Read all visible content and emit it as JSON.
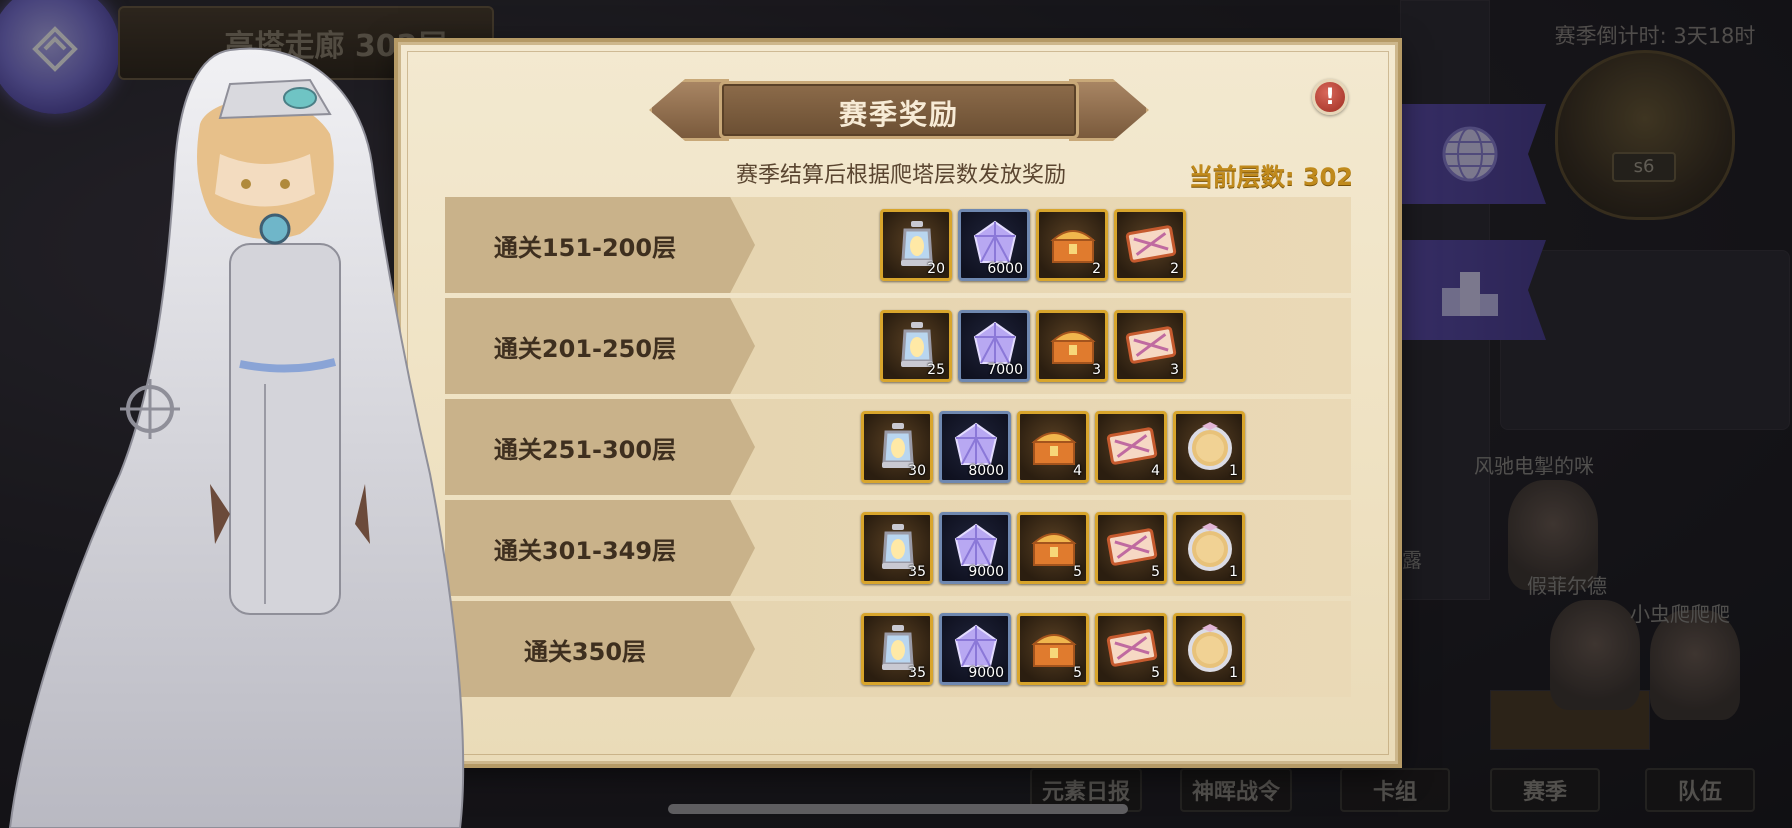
{
  "hud": {
    "tower_title": "高塔走廊 302层",
    "season_countdown": "赛季倒计时: 3天18时",
    "season_badge": "s6"
  },
  "players": [
    {
      "name": "风驰电掣的咪"
    },
    {
      "name": "假菲尔德"
    },
    {
      "name": "小虫爬爬爬"
    },
    {
      "name": "露"
    }
  ],
  "bottom_nav": [
    {
      "label": "元素日报"
    },
    {
      "label": "神晖战令"
    },
    {
      "label": "卡组"
    },
    {
      "label": "赛季"
    },
    {
      "label": "队伍"
    }
  ],
  "panel": {
    "title": "赛季奖励",
    "info_icon": "exclamation-icon",
    "subtitle": "赛季结算后根据爬塔层数发放奖励",
    "current_floor": "当前层数: 302",
    "tiers": [
      {
        "label": "通关151-200层",
        "items": [
          {
            "icon": "lantern",
            "qty": "20"
          },
          {
            "icon": "crystal",
            "qty": "6000"
          },
          {
            "icon": "chest",
            "qty": "2"
          },
          {
            "icon": "ticket",
            "qty": "2"
          }
        ]
      },
      {
        "label": "通关201-250层",
        "items": [
          {
            "icon": "lantern",
            "qty": "25"
          },
          {
            "icon": "crystal",
            "qty": "7000"
          },
          {
            "icon": "chest",
            "qty": "3"
          },
          {
            "icon": "ticket",
            "qty": "3"
          }
        ]
      },
      {
        "label": "通关251-300层",
        "items": [
          {
            "icon": "lantern",
            "qty": "30"
          },
          {
            "icon": "crystal",
            "qty": "8000"
          },
          {
            "icon": "chest",
            "qty": "4"
          },
          {
            "icon": "ticket",
            "qty": "4"
          },
          {
            "icon": "frame",
            "qty": "1"
          }
        ]
      },
      {
        "label": "通关301-349层",
        "items": [
          {
            "icon": "lantern",
            "qty": "35"
          },
          {
            "icon": "crystal",
            "qty": "9000"
          },
          {
            "icon": "chest",
            "qty": "5"
          },
          {
            "icon": "ticket",
            "qty": "5"
          },
          {
            "icon": "frame",
            "qty": "1"
          }
        ]
      },
      {
        "label": "通关350层",
        "items": [
          {
            "icon": "lantern",
            "qty": "35"
          },
          {
            "icon": "crystal",
            "qty": "9000"
          },
          {
            "icon": "chest",
            "qty": "5"
          },
          {
            "icon": "ticket",
            "qty": "5"
          },
          {
            "icon": "frame",
            "qty": "1"
          }
        ]
      }
    ]
  }
}
